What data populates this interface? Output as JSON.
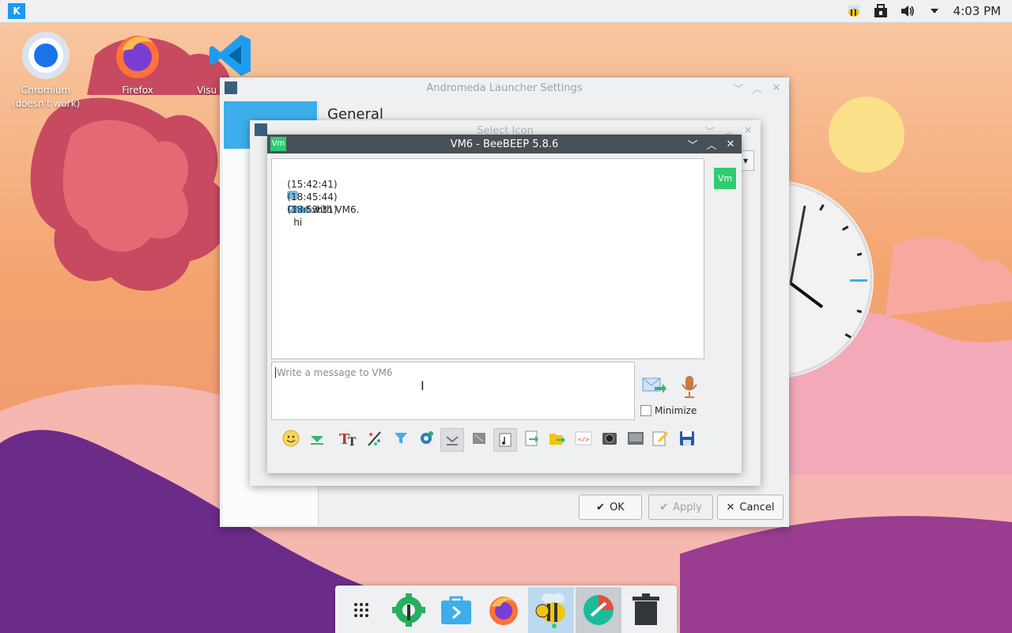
{
  "panel": {
    "clock": "4:03 PM",
    "tray_icons": [
      "beebeep-tray-icon",
      "vault-icon",
      "volume-icon",
      "expand-tray-icon"
    ]
  },
  "desktop": {
    "icons": [
      {
        "name": "Chromium",
        "sub": "(doesn't work)",
        "icon": "chromium-icon"
      },
      {
        "name": "Firefox",
        "icon": "firefox-icon"
      },
      {
        "name": "Visu",
        "icon": "vscode-icon"
      }
    ]
  },
  "settings_window": {
    "title": "Andromeda Launcher Settings",
    "section": "General",
    "ok_label": "OK",
    "apply_label": "Apply",
    "cancel_label": "Cancel"
  },
  "select_icon_window": {
    "title": "Select Icon"
  },
  "chat_window": {
    "app_badge": "Vm",
    "title": "VM6 - BeeBEEP 5.8.6",
    "messages": [
      {
        "time": "(15:42:41)",
        "text": "Chat with VM6."
      },
      {
        "time": "(18:45:44)",
        "user": "VM6",
        "text": ": hi"
      },
      {
        "time": "(18:53:31)",
        "text": "hi"
      }
    ],
    "user_badge": "Vm",
    "input_placeholder": "Write a message to VM6",
    "minimize_label": "Minimize",
    "colors": {
      "accent": "#2ecc71",
      "user": "#3daee9",
      "titlebar": "#475057"
    }
  },
  "dock": {
    "items": [
      "app-grid-icon",
      "settings-gear-icon",
      "store-icon",
      "firefox-icon",
      "beebeep-icon",
      "andromeda-icon",
      "trash-icon"
    ]
  }
}
